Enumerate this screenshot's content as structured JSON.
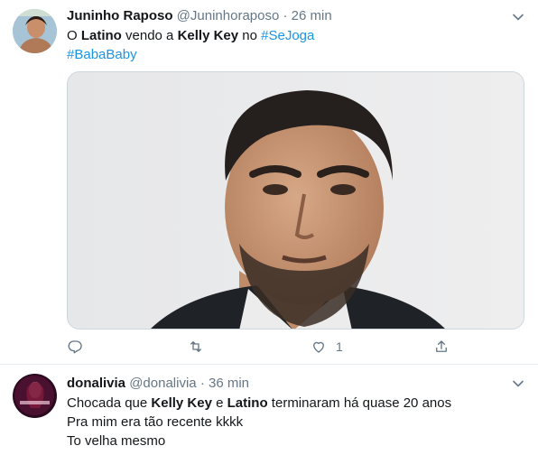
{
  "tweets": [
    {
      "display_name": "Juninho Raposo",
      "handle": "@Juninhoraposo",
      "separator": "·",
      "time": "26 min",
      "text_lines": [
        [
          {
            "t": "O "
          },
          {
            "t": "Latino",
            "b": true
          },
          {
            "t": " vendo a "
          },
          {
            "t": "Kelly Key",
            "b": true
          },
          {
            "t": " no "
          },
          {
            "t": "#SeJoga",
            "h": true
          }
        ],
        [
          {
            "t": "#BabaBaby",
            "h": true
          }
        ]
      ],
      "actions": {
        "reply_count": "",
        "retweet_count": "",
        "like_count": "1",
        "share_count": ""
      }
    },
    {
      "display_name": "donalivia",
      "handle": "@donalivia",
      "separator": "·",
      "time": "36 min",
      "line1_parts": [
        "Chocada que ",
        "Kelly Key",
        " e ",
        "Latino",
        " terminaram há quase 20 anos"
      ],
      "line2": "Pra mim era tão recente kkkk",
      "line3": "To velha mesmo"
    }
  ],
  "icons": {
    "chevron": "chevron-down-icon",
    "reply": "reply-icon",
    "retweet": "retweet-icon",
    "like": "heart-icon",
    "share": "share-icon"
  },
  "colors": {
    "hashtag": "#1b95e0",
    "muted": "#657786",
    "divider": "#e6ecf0"
  }
}
